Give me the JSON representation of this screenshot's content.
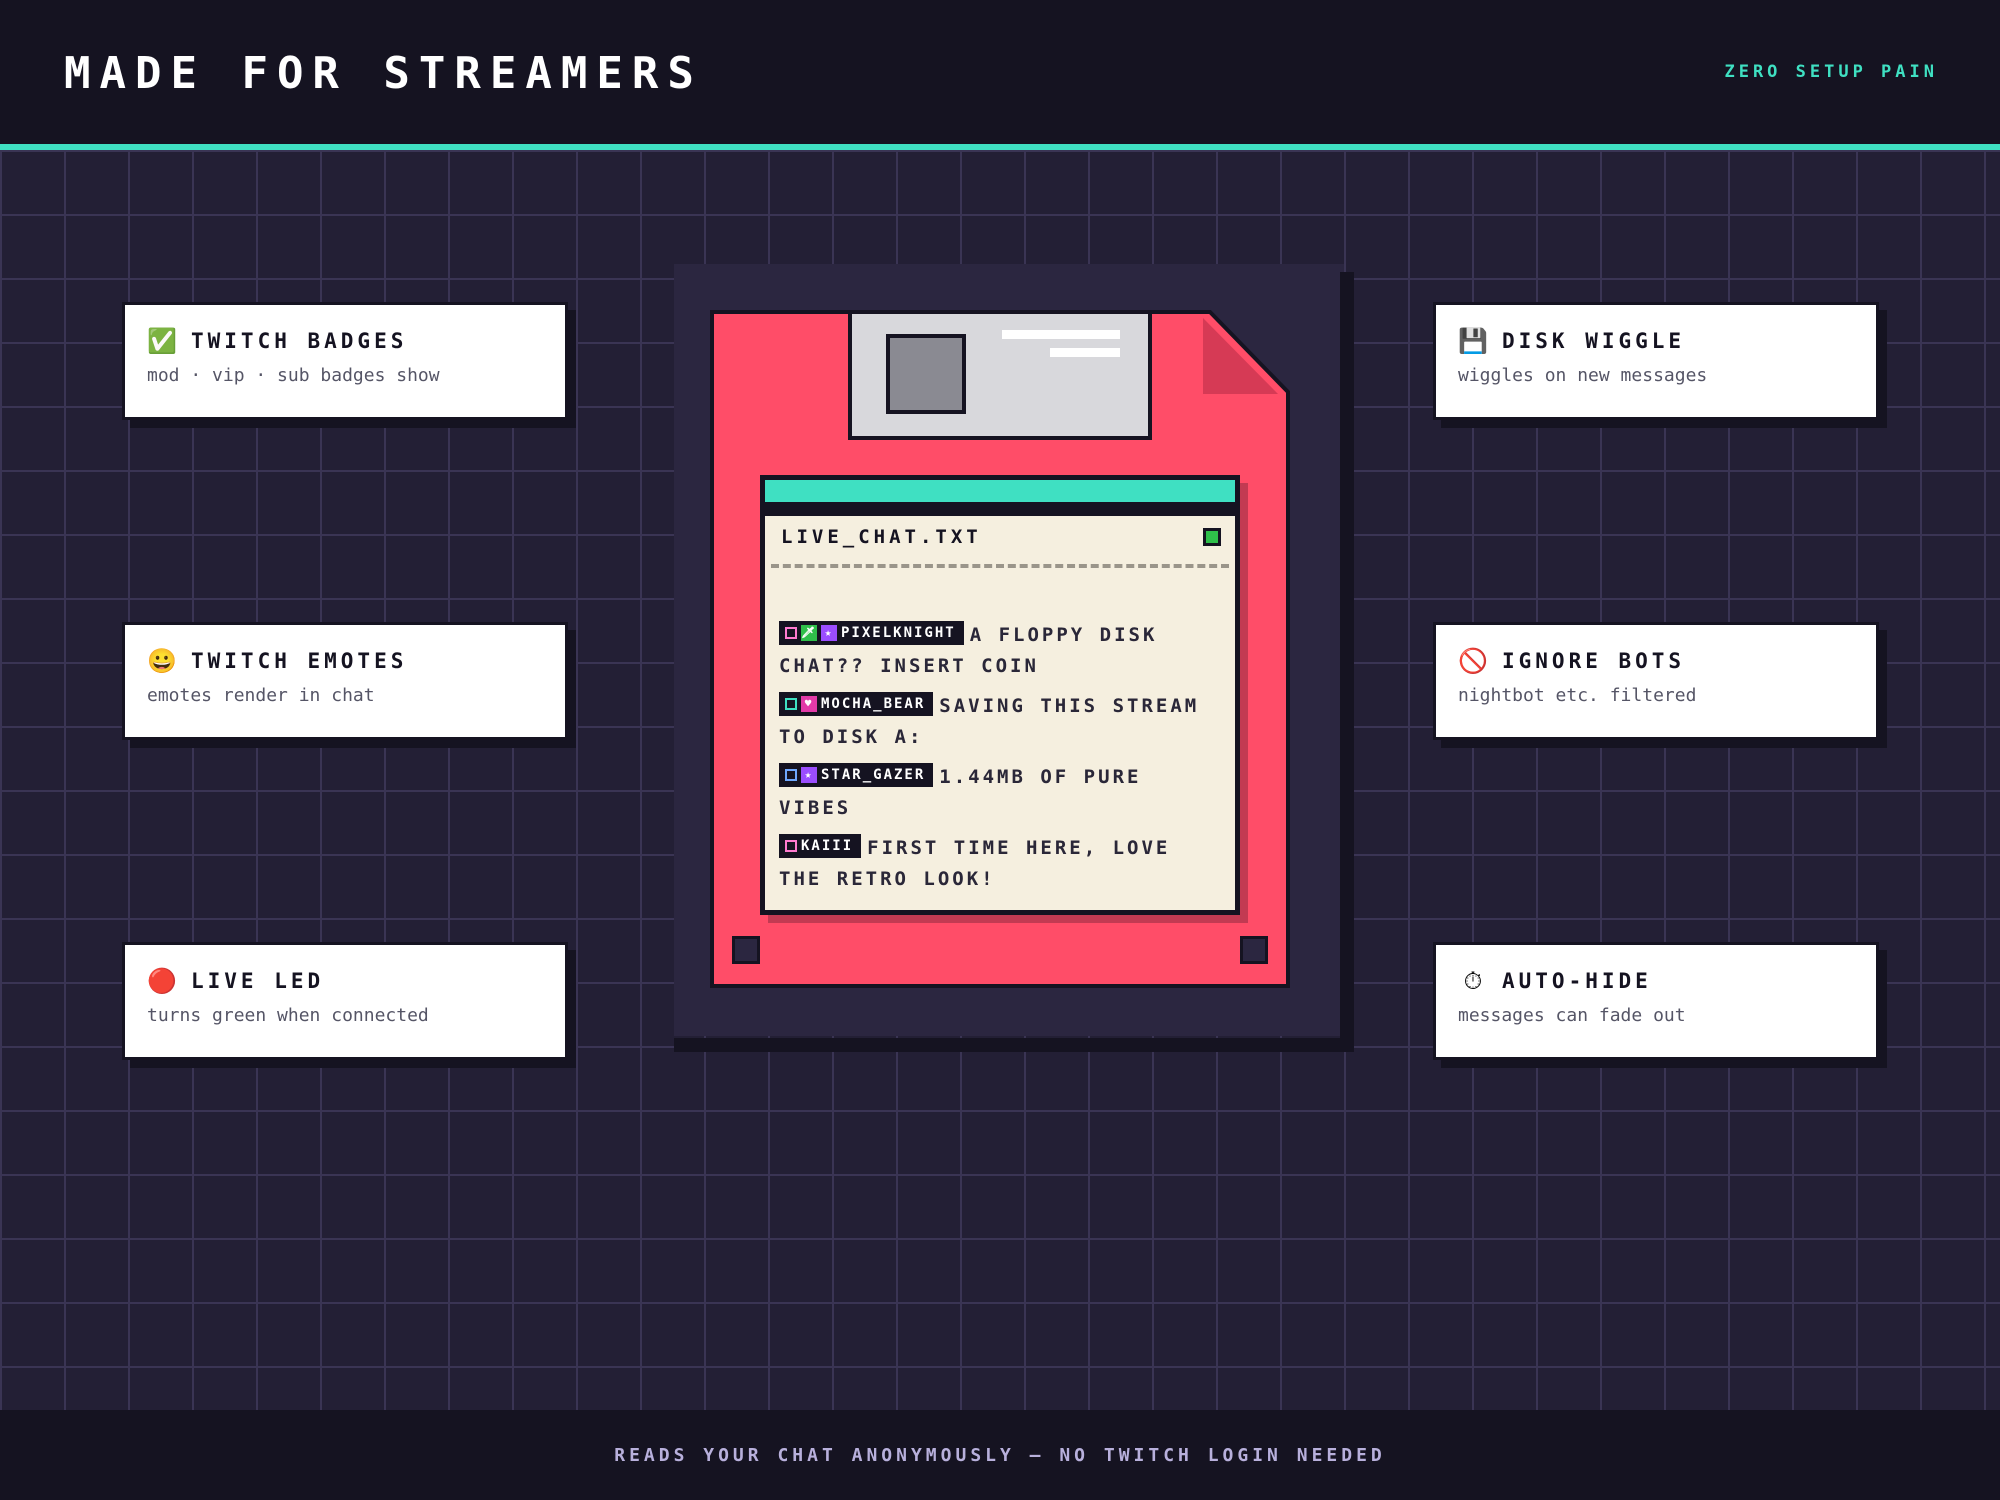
{
  "header": {
    "title": "MADE FOR STREAMERS",
    "tagline": "ZERO SETUP PAIN"
  },
  "footer": {
    "text": "READS YOUR CHAT ANONYMOUSLY — NO TWITCH LOGIN NEEDED"
  },
  "features_left": [
    {
      "icon": "✅",
      "icon_name": "check-icon",
      "title": "TWITCH BADGES",
      "desc": "mod · vip · sub badges show"
    },
    {
      "icon": "😀",
      "icon_name": "smiley-icon",
      "title": "TWITCH EMOTES",
      "desc": "emotes render in chat"
    },
    {
      "icon": "🔴",
      "icon_name": "red-circle-icon",
      "title": "LIVE LED",
      "desc": "turns green when connected"
    }
  ],
  "features_right": [
    {
      "icon": "💾",
      "icon_name": "floppy-disk-icon",
      "title": "DISK WIGGLE",
      "desc": "wiggles on new messages"
    },
    {
      "icon": "🚫",
      "icon_name": "prohibited-icon",
      "title": "IGNORE BOTS",
      "desc": "nightbot etc. filtered"
    },
    {
      "icon": "⏱",
      "icon_name": "stopwatch-icon",
      "title": "AUTO-HIDE",
      "desc": "messages can fade out"
    }
  ],
  "chat": {
    "title": "LIVE_CHAT.TXT",
    "messages": [
      {
        "user": "PIXELKNIGHT",
        "text": "A FLOPPY DISK CHAT?? INSERT COIN",
        "badges": [
          "square-pink",
          "mod-green",
          "sub-purple"
        ]
      },
      {
        "user": "MOCHA_BEAR",
        "text": "SAVING THIS STREAM TO DISK A:",
        "badges": [
          "square-teal",
          "vip-pink"
        ]
      },
      {
        "user": "STAR_GAZER",
        "text": "1.44MB OF PURE VIBES",
        "badges": [
          "square-blue",
          "sub-purple"
        ]
      },
      {
        "user": "KAIII",
        "text": "FIRST TIME HERE, LOVE THE RETRO LOOK!",
        "badges": [
          "square-pink"
        ]
      }
    ]
  },
  "colors": {
    "accent": "#3fe0c2",
    "floppy": "#ff4d68",
    "background": "#231f35",
    "led": "#2fbf4a"
  }
}
